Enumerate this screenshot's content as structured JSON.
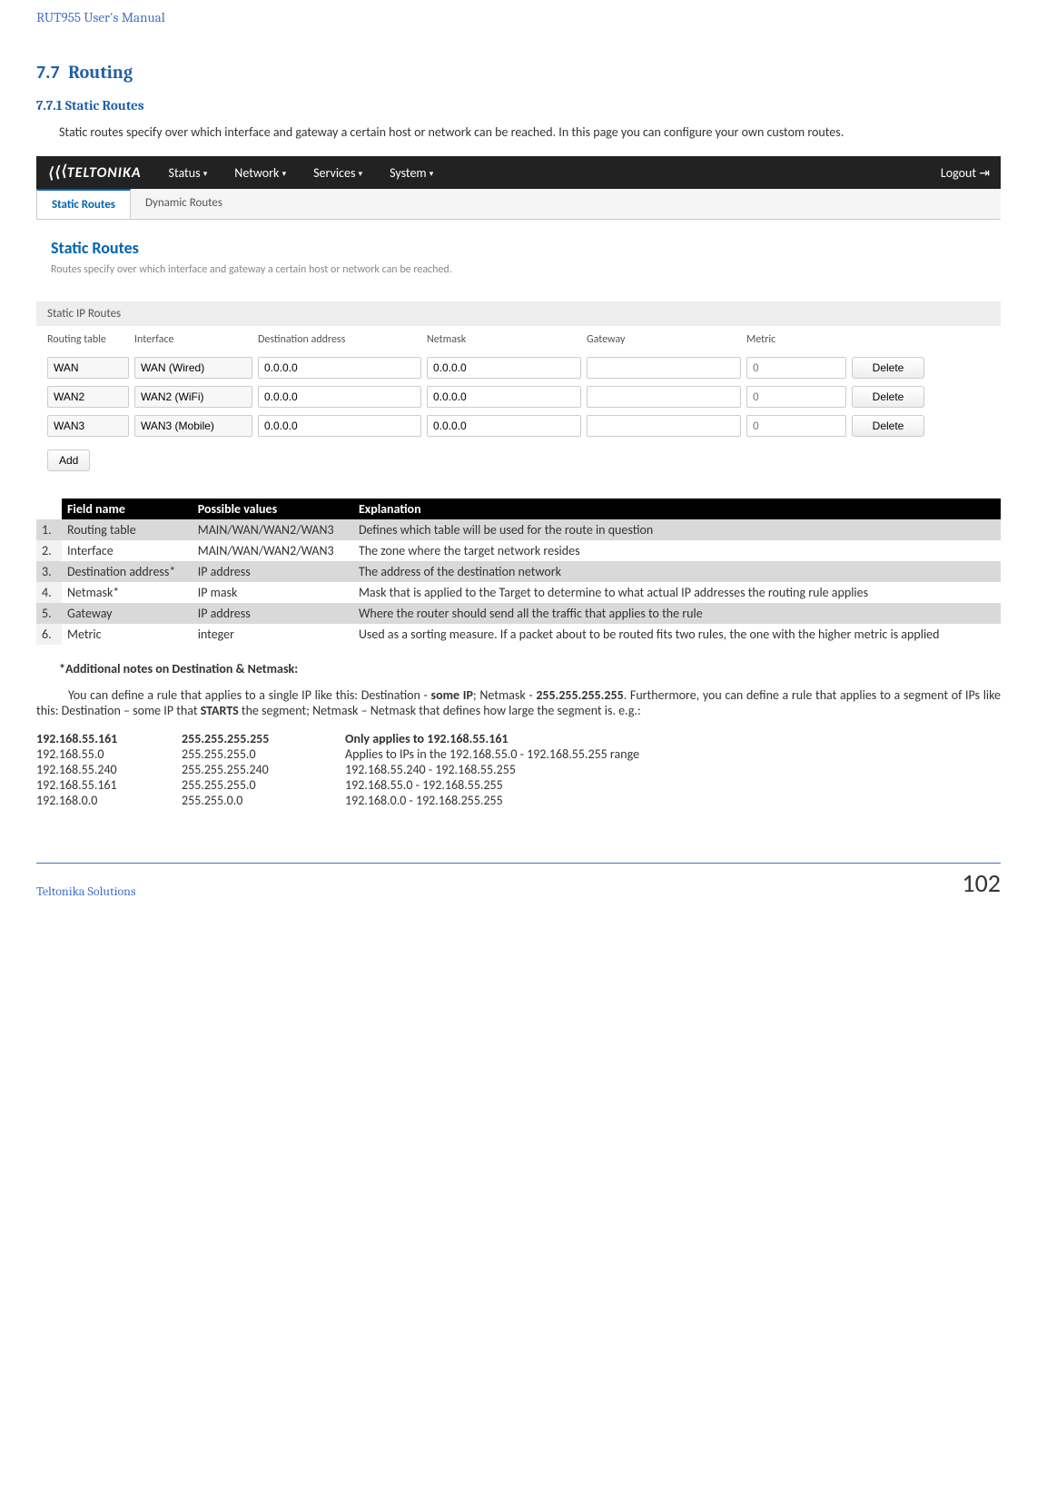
{
  "header": {
    "title": "RUT955 User's Manual"
  },
  "section": {
    "num": "7.7",
    "title": "Routing",
    "subnum": "7.7.1",
    "subtitle": "Static Routes"
  },
  "intro": "Static routes specify over which interface and gateway a certain host or network can be reached. In this page you can configure your own custom routes.",
  "ui": {
    "brand": "TELTONIKA",
    "menu": [
      "Status",
      "Network",
      "Services",
      "System"
    ],
    "logout": "Logout",
    "tabs": {
      "active": "Static Routes",
      "other": "Dynamic Routes"
    },
    "panel_title": "Static Routes",
    "panel_desc": "Routes specify over which interface and gateway a certain host or network can be reached.",
    "subhead": "Static IP Routes",
    "cols": [
      "Routing table",
      "Interface",
      "Destination address",
      "Netmask",
      "Gateway",
      "Metric",
      ""
    ],
    "rows": [
      {
        "table": "WAN",
        "iface": "WAN (Wired)",
        "dest": "0.0.0.0",
        "mask": "0.0.0.0",
        "gw": "",
        "metric": "0",
        "del": "Delete"
      },
      {
        "table": "WAN2",
        "iface": "WAN2 (WiFi)",
        "dest": "0.0.0.0",
        "mask": "0.0.0.0",
        "gw": "",
        "metric": "0",
        "del": "Delete"
      },
      {
        "table": "WAN3",
        "iface": "WAN3 (Mobile)",
        "dest": "0.0.0.0",
        "mask": "0.0.0.0",
        "gw": "",
        "metric": "0",
        "del": "Delete"
      }
    ],
    "add": "Add"
  },
  "fields": {
    "head": [
      "",
      "Field name",
      "Possible values",
      "Explanation"
    ],
    "rows": [
      {
        "n": "1.",
        "name": "Routing table",
        "vals": "MAIN/WAN/WAN2/WAN3",
        "expl": "Defines which table will be used for the route in question"
      },
      {
        "n": "2.",
        "name": "Interface",
        "vals": "MAIN/WAN/WAN2/WAN3",
        "expl": "The zone where the target network resides"
      },
      {
        "n": "3.",
        "name": "Destination address*",
        "vals": "IP address",
        "expl": "The address of the destination network"
      },
      {
        "n": "4.",
        "name": "Netmask*",
        "vals": "IP mask",
        "expl": "Mask that is applied to the Target to determine to what actual IP addresses the routing rule applies"
      },
      {
        "n": "5.",
        "name": "Gateway",
        "vals": "IP address",
        "expl": "Where the router should send all the traffic that applies to the rule"
      },
      {
        "n": "6.",
        "name": "Metric",
        "vals": "integer",
        "expl": "Used as a sorting measure. If a packet about to be routed fits two rules, the one with the higher metric is applied"
      }
    ]
  },
  "notes": {
    "title": "*Additional notes on Destination & Netmask:",
    "body_pre": "You can define a rule that applies to a single IP like this: Destination - ",
    "some_ip": "some IP",
    "body_mid1": "; Netmask - ",
    "mask_all": "255.255.255.255",
    "body_mid2": ". Furthermore, you can define a rule that applies to a segment of IPs like this: Destination – some IP that ",
    "starts": "STARTS",
    "body_post": " the segment; Netmask – Netmask that defines how large the segment is. e.g.:"
  },
  "examples": [
    {
      "ip": "192.168.55.161",
      "mask": "255.255.255.255",
      "desc": "Only applies to 192.168.55.161",
      "bold": true
    },
    {
      "ip": "192.168.55.0",
      "mask": "255.255.255.0",
      "desc": "Applies to IPs in the 192.168.55.0 - 192.168.55.255 range"
    },
    {
      "ip": "192.168.55.240",
      "mask": "255.255.255.240",
      "desc": "192.168.55.240 -  192.168.55.255"
    },
    {
      "ip": "192.168.55.161",
      "mask": "255.255.255.0",
      "desc": "192.168.55.0 - 192.168.55.255"
    },
    {
      "ip": "192.168.0.0",
      "mask": "255.255.0.0",
      "desc": "192.168.0.0 - 192.168.255.255"
    }
  ],
  "footer": {
    "left": "Teltonika Solutions",
    "right": "102"
  }
}
